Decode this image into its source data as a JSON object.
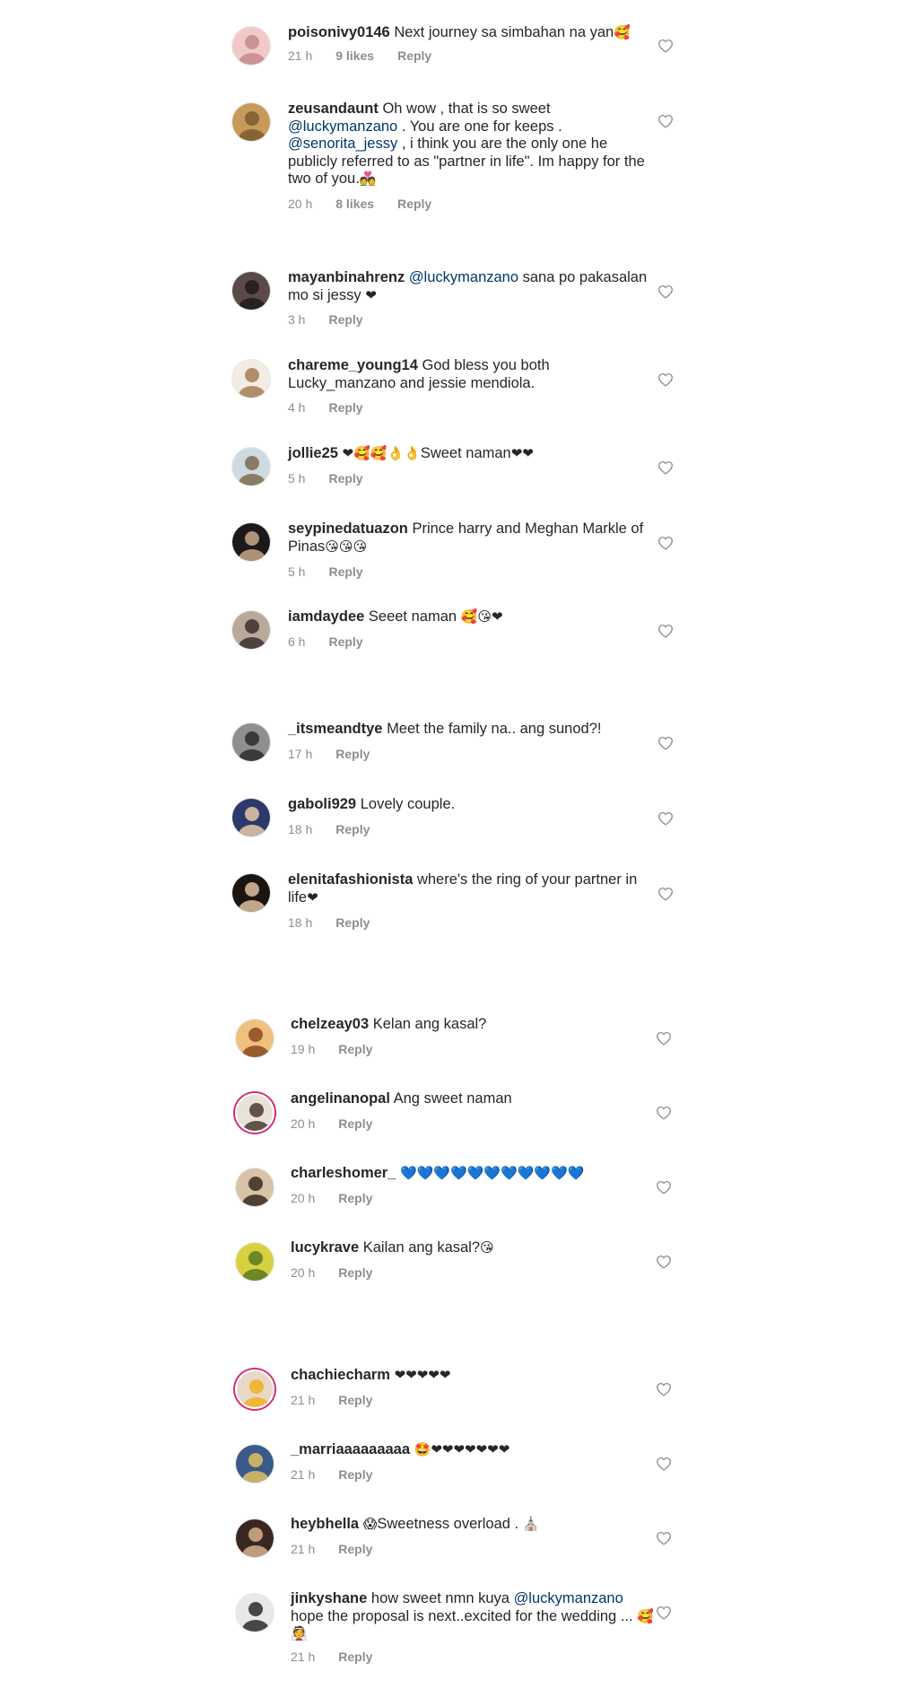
{
  "comments": [
    {
      "user": "poisonivy0146",
      "parts": [
        {
          "t": "Next journey sa simbahan na yan"
        },
        {
          "e": "🥰"
        }
      ],
      "time": "21 h",
      "likes": "9 likes",
      "reply": "Reply",
      "avatar": [
        "#f2c9c9",
        "#c48a8a"
      ],
      "ring": false
    },
    {
      "user": "zeusandaunt",
      "parts": [
        {
          "t": "Oh wow , that is so sweet "
        },
        {
          "m": "@luckymanzano"
        },
        {
          "t": " . You are one for keeps . "
        },
        {
          "m": "@senorita_jessy"
        },
        {
          "t": " , i think you  are the only one he publicly referred to as \"partner  in life\". Im happy for the two of you."
        },
        {
          "e": "💑"
        }
      ],
      "time": "20 h",
      "likes": "8 likes",
      "reply": "Reply",
      "avatar": [
        "#c79a5a",
        "#7a5a2e"
      ],
      "ring": false
    },
    {
      "user": "mayanbinahrenz",
      "parts": [
        {
          "m": "@luckymanzano"
        },
        {
          "t": " sana po pakasalan mo si jessy "
        },
        {
          "e": "❤"
        }
      ],
      "time": "3 h",
      "likes": "",
      "reply": "Reply",
      "avatar": [
        "#5a4a4a",
        "#1e1a1a"
      ],
      "ring": false
    },
    {
      "user": "chareme_young14",
      "parts": [
        {
          "t": "God bless you both Lucky_manzano and jessie mendiola."
        }
      ],
      "time": "4 h",
      "likes": "",
      "reply": "Reply",
      "avatar": [
        "#f3ece2",
        "#a67c52"
      ],
      "ring": false
    },
    {
      "user": "jollie25",
      "parts": [
        {
          "e": "❤🥰🥰👌👌"
        },
        {
          "t": "Sweet naman"
        },
        {
          "e": "❤❤"
        }
      ],
      "time": "5 h",
      "likes": "",
      "reply": "Reply",
      "avatar": [
        "#cfd9e0",
        "#7d6a4f"
      ],
      "ring": false
    },
    {
      "user": "seypinedatuazon",
      "parts": [
        {
          "t": "Prince harry and Meghan Markle of Pinas"
        },
        {
          "e": "😘😘😘"
        }
      ],
      "time": "5 h",
      "likes": "",
      "reply": "Reply",
      "avatar": [
        "#1a1a1a",
        "#c8a88a"
      ],
      "ring": false
    },
    {
      "user": "iamdaydee",
      "parts": [
        {
          "t": "Seeet naman "
        },
        {
          "e": "🥰😘❤"
        }
      ],
      "time": "6 h",
      "likes": "",
      "reply": "Reply",
      "avatar": [
        "#b9a99a",
        "#3a3030"
      ],
      "ring": false
    },
    {
      "user": "_itsmeandtye",
      "parts": [
        {
          "t": "Meet the family na.. ang sunod?!"
        }
      ],
      "time": "17 h",
      "likes": "",
      "reply": "Reply",
      "avatar": [
        "#8f8f8f",
        "#2c2c2c"
      ],
      "ring": false
    },
    {
      "user": "gaboli929",
      "parts": [
        {
          "t": "Lovely couple."
        }
      ],
      "time": "18 h",
      "likes": "",
      "reply": "Reply",
      "avatar": [
        "#2b3a6b",
        "#e8c9a8"
      ],
      "ring": false
    },
    {
      "user": "elenitafashionista",
      "parts": [
        {
          "t": "where's the ring of your partner in life"
        },
        {
          "e": "❤"
        }
      ],
      "time": "18 h",
      "likes": "",
      "reply": "Reply",
      "avatar": [
        "#1a1510",
        "#e0c0a0"
      ],
      "ring": false
    },
    {
      "user": "chelzeay03",
      "parts": [
        {
          "t": "Kelan ang kasal?"
        }
      ],
      "time": "19 h",
      "likes": "",
      "reply": "Reply",
      "avatar": [
        "#f0c080",
        "#8a4a1e"
      ],
      "ring": false
    },
    {
      "user": "angelinanopal",
      "parts": [
        {
          "t": "Ang sweet naman"
        }
      ],
      "time": "20 h",
      "likes": "",
      "reply": "Reply",
      "avatar": [
        "#e9e2d6",
        "#4a3a30"
      ],
      "ring": true
    },
    {
      "user": "charleshomer_",
      "parts": [
        {
          "e": "💙💙💙💙💙💙💙💙💙💙💙"
        }
      ],
      "time": "20 h",
      "likes": "",
      "reply": "Reply",
      "avatar": [
        "#d8c2a8",
        "#3a2a1e"
      ],
      "ring": false
    },
    {
      "user": "lucykrave",
      "parts": [
        {
          "t": "Kailan ang kasal?"
        },
        {
          "e": "😘"
        }
      ],
      "time": "20 h",
      "likes": "",
      "reply": "Reply",
      "avatar": [
        "#d8d040",
        "#5a7a20"
      ],
      "ring": false
    },
    {
      "user": "chachiecharm",
      "parts": [
        {
          "e": "❤❤❤❤❤"
        }
      ],
      "time": "21 h",
      "likes": "",
      "reply": "Reply",
      "avatar": [
        "#e8d8c8",
        "#f0b020"
      ],
      "ring": true
    },
    {
      "user": "_marriaaaaaaaaa",
      "parts": [
        {
          "e": "🤩❤❤❤❤❤❤❤"
        }
      ],
      "time": "21 h",
      "likes": "",
      "reply": "Reply",
      "avatar": [
        "#3a5a8a",
        "#e0c060"
      ],
      "ring": false
    },
    {
      "user": "heybhella",
      "parts": [
        {
          "e": "😱"
        },
        {
          "t": "Sweetness  overload . "
        },
        {
          "e": "⛪"
        }
      ],
      "time": "21 h",
      "likes": "",
      "reply": "Reply",
      "avatar": [
        "#3a2820",
        "#d8b090"
      ],
      "ring": false
    },
    {
      "user": "jinkyshane",
      "parts": [
        {
          "t": "how sweet nmn kuya "
        },
        {
          "m": "@luckymanzano"
        },
        {
          "t": " hope the proposal is next..excited for the wedding ... "
        },
        {
          "e": "🥰👰"
        }
      ],
      "time": "21 h",
      "likes": "",
      "reply": "Reply",
      "avatar": [
        "#e8e8e8",
        "#2a2a2a"
      ],
      "ring": false
    }
  ],
  "colors": {
    "text": "#262626",
    "meta": "#8e8e8e",
    "mention": "#00376b",
    "heart_outline": "#8e8e8e",
    "ring": "#d62976"
  },
  "icons": {
    "heart": "heart-outline-icon"
  }
}
